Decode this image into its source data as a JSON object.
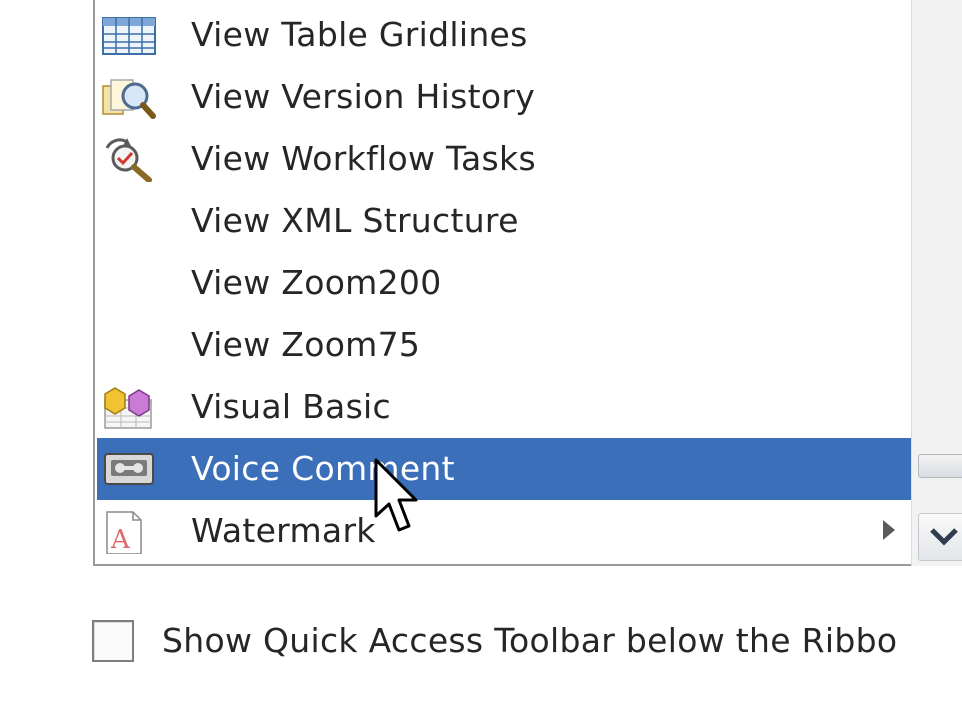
{
  "menu": {
    "items": [
      {
        "label": "View Table Gridlines",
        "icon": "table-gridlines-icon",
        "has_submenu": false,
        "selected": false
      },
      {
        "label": "View Version History",
        "icon": "version-history-icon",
        "has_submenu": false,
        "selected": false
      },
      {
        "label": "View Workflow Tasks",
        "icon": "workflow-tasks-icon",
        "has_submenu": false,
        "selected": false
      },
      {
        "label": "View XML Structure",
        "icon": "",
        "has_submenu": false,
        "selected": false
      },
      {
        "label": "View Zoom200",
        "icon": "",
        "has_submenu": false,
        "selected": false
      },
      {
        "label": "View Zoom75",
        "icon": "",
        "has_submenu": false,
        "selected": false
      },
      {
        "label": "Visual Basic",
        "icon": "visual-basic-icon",
        "has_submenu": false,
        "selected": false
      },
      {
        "label": "Voice Comment",
        "icon": "voice-comment-icon",
        "has_submenu": false,
        "selected": true
      },
      {
        "label": "Watermark",
        "icon": "watermark-icon",
        "has_submenu": true,
        "selected": false
      }
    ]
  },
  "quick_access": {
    "checkbox_label": "Show Quick Access Toolbar below the Ribbo",
    "checked": false
  },
  "colors": {
    "selection": "#3c6fb9",
    "border": "#9a9a9a"
  }
}
